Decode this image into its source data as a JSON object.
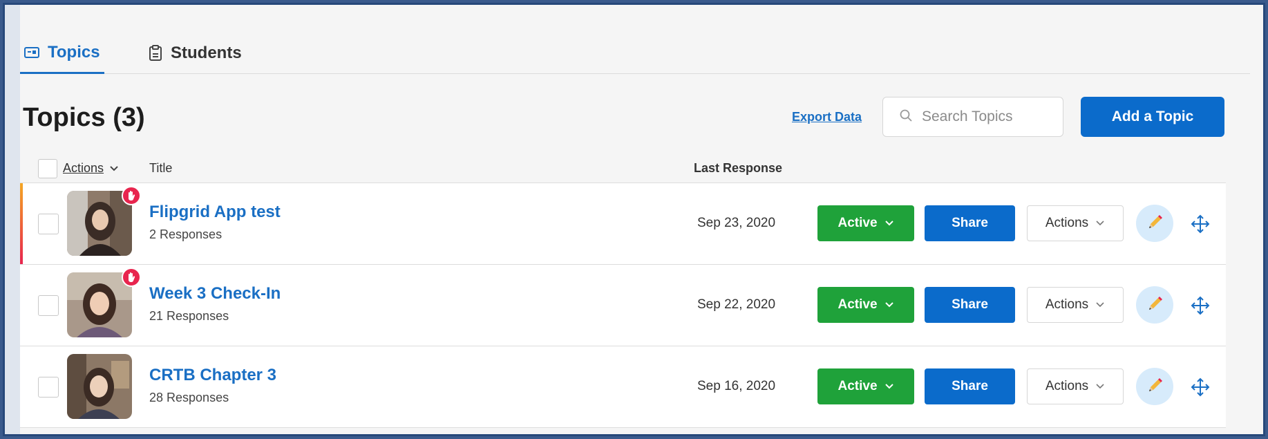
{
  "tabs": [
    {
      "label": "Topics",
      "icon": "topics-card-icon",
      "active": true
    },
    {
      "label": "Students",
      "icon": "clipboard-icon",
      "active": false
    }
  ],
  "header": {
    "title": "Topics (3)",
    "export_label": "Export Data",
    "search_placeholder": "Search Topics",
    "add_label": "Add a Topic"
  },
  "columns": {
    "actions": "Actions",
    "title": "Title",
    "last_response": "Last Response"
  },
  "topics": [
    {
      "title": "Flipgrid App test",
      "responses": "2 Responses",
      "date": "Sep 23, 2020",
      "status": "Active",
      "share": "Share",
      "actions": "Actions"
    },
    {
      "title": "Week 3 Check-In",
      "responses": "21 Responses",
      "date": "Sep 22, 2020",
      "status": "Active",
      "share": "Share",
      "actions": "Actions"
    },
    {
      "title": "CRTB Chapter 3",
      "responses": "28 Responses",
      "date": "Sep 16, 2020",
      "status": "Active",
      "share": "Share",
      "actions": "Actions"
    }
  ],
  "colors": {
    "accent_blue": "#0b6bcb",
    "link_blue": "#1a6fc4",
    "active_green": "#1fa23a",
    "badge_red": "#e8254e"
  }
}
